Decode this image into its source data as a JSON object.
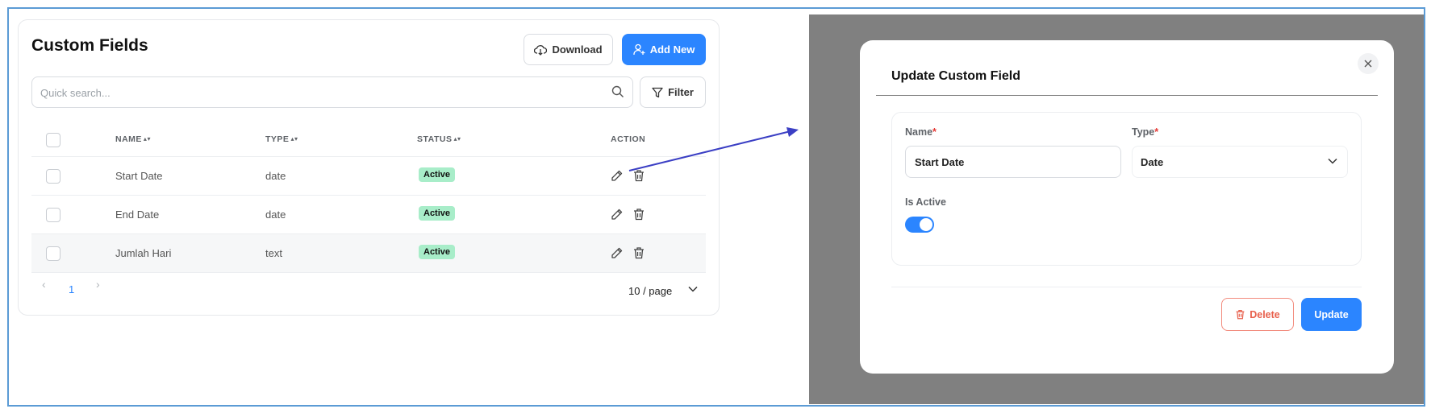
{
  "left": {
    "title": "Custom Fields",
    "download_label": "Download",
    "add_new_label": "Add New",
    "search_placeholder": "Quick search...",
    "filter_label": "Filter",
    "columns": {
      "name": "NAME",
      "type": "TYPE",
      "status": "STATUS",
      "action": "ACTION"
    },
    "rows": [
      {
        "name": "Start Date",
        "type": "date",
        "status": "Active"
      },
      {
        "name": "End Date",
        "type": "date",
        "status": "Active"
      },
      {
        "name": "Jumlah Hari",
        "type": "text",
        "status": "Active"
      }
    ],
    "pagination": {
      "prev": "‹",
      "current": "1",
      "next": "›",
      "page_size": "10 / page"
    }
  },
  "modal": {
    "title": "Update Custom Field",
    "name_label": "Name",
    "name_value": "Start Date",
    "type_label": "Type",
    "type_value": "Date",
    "required_mark": "*",
    "is_active_label": "Is Active",
    "is_active": true,
    "delete_label": "Delete",
    "update_label": "Update"
  },
  "colors": {
    "accent": "#2b85ff",
    "active_badge": "#a8edc9",
    "danger": "#e8604c",
    "overlay": "#808080",
    "arrow": "#3b3fc4"
  }
}
